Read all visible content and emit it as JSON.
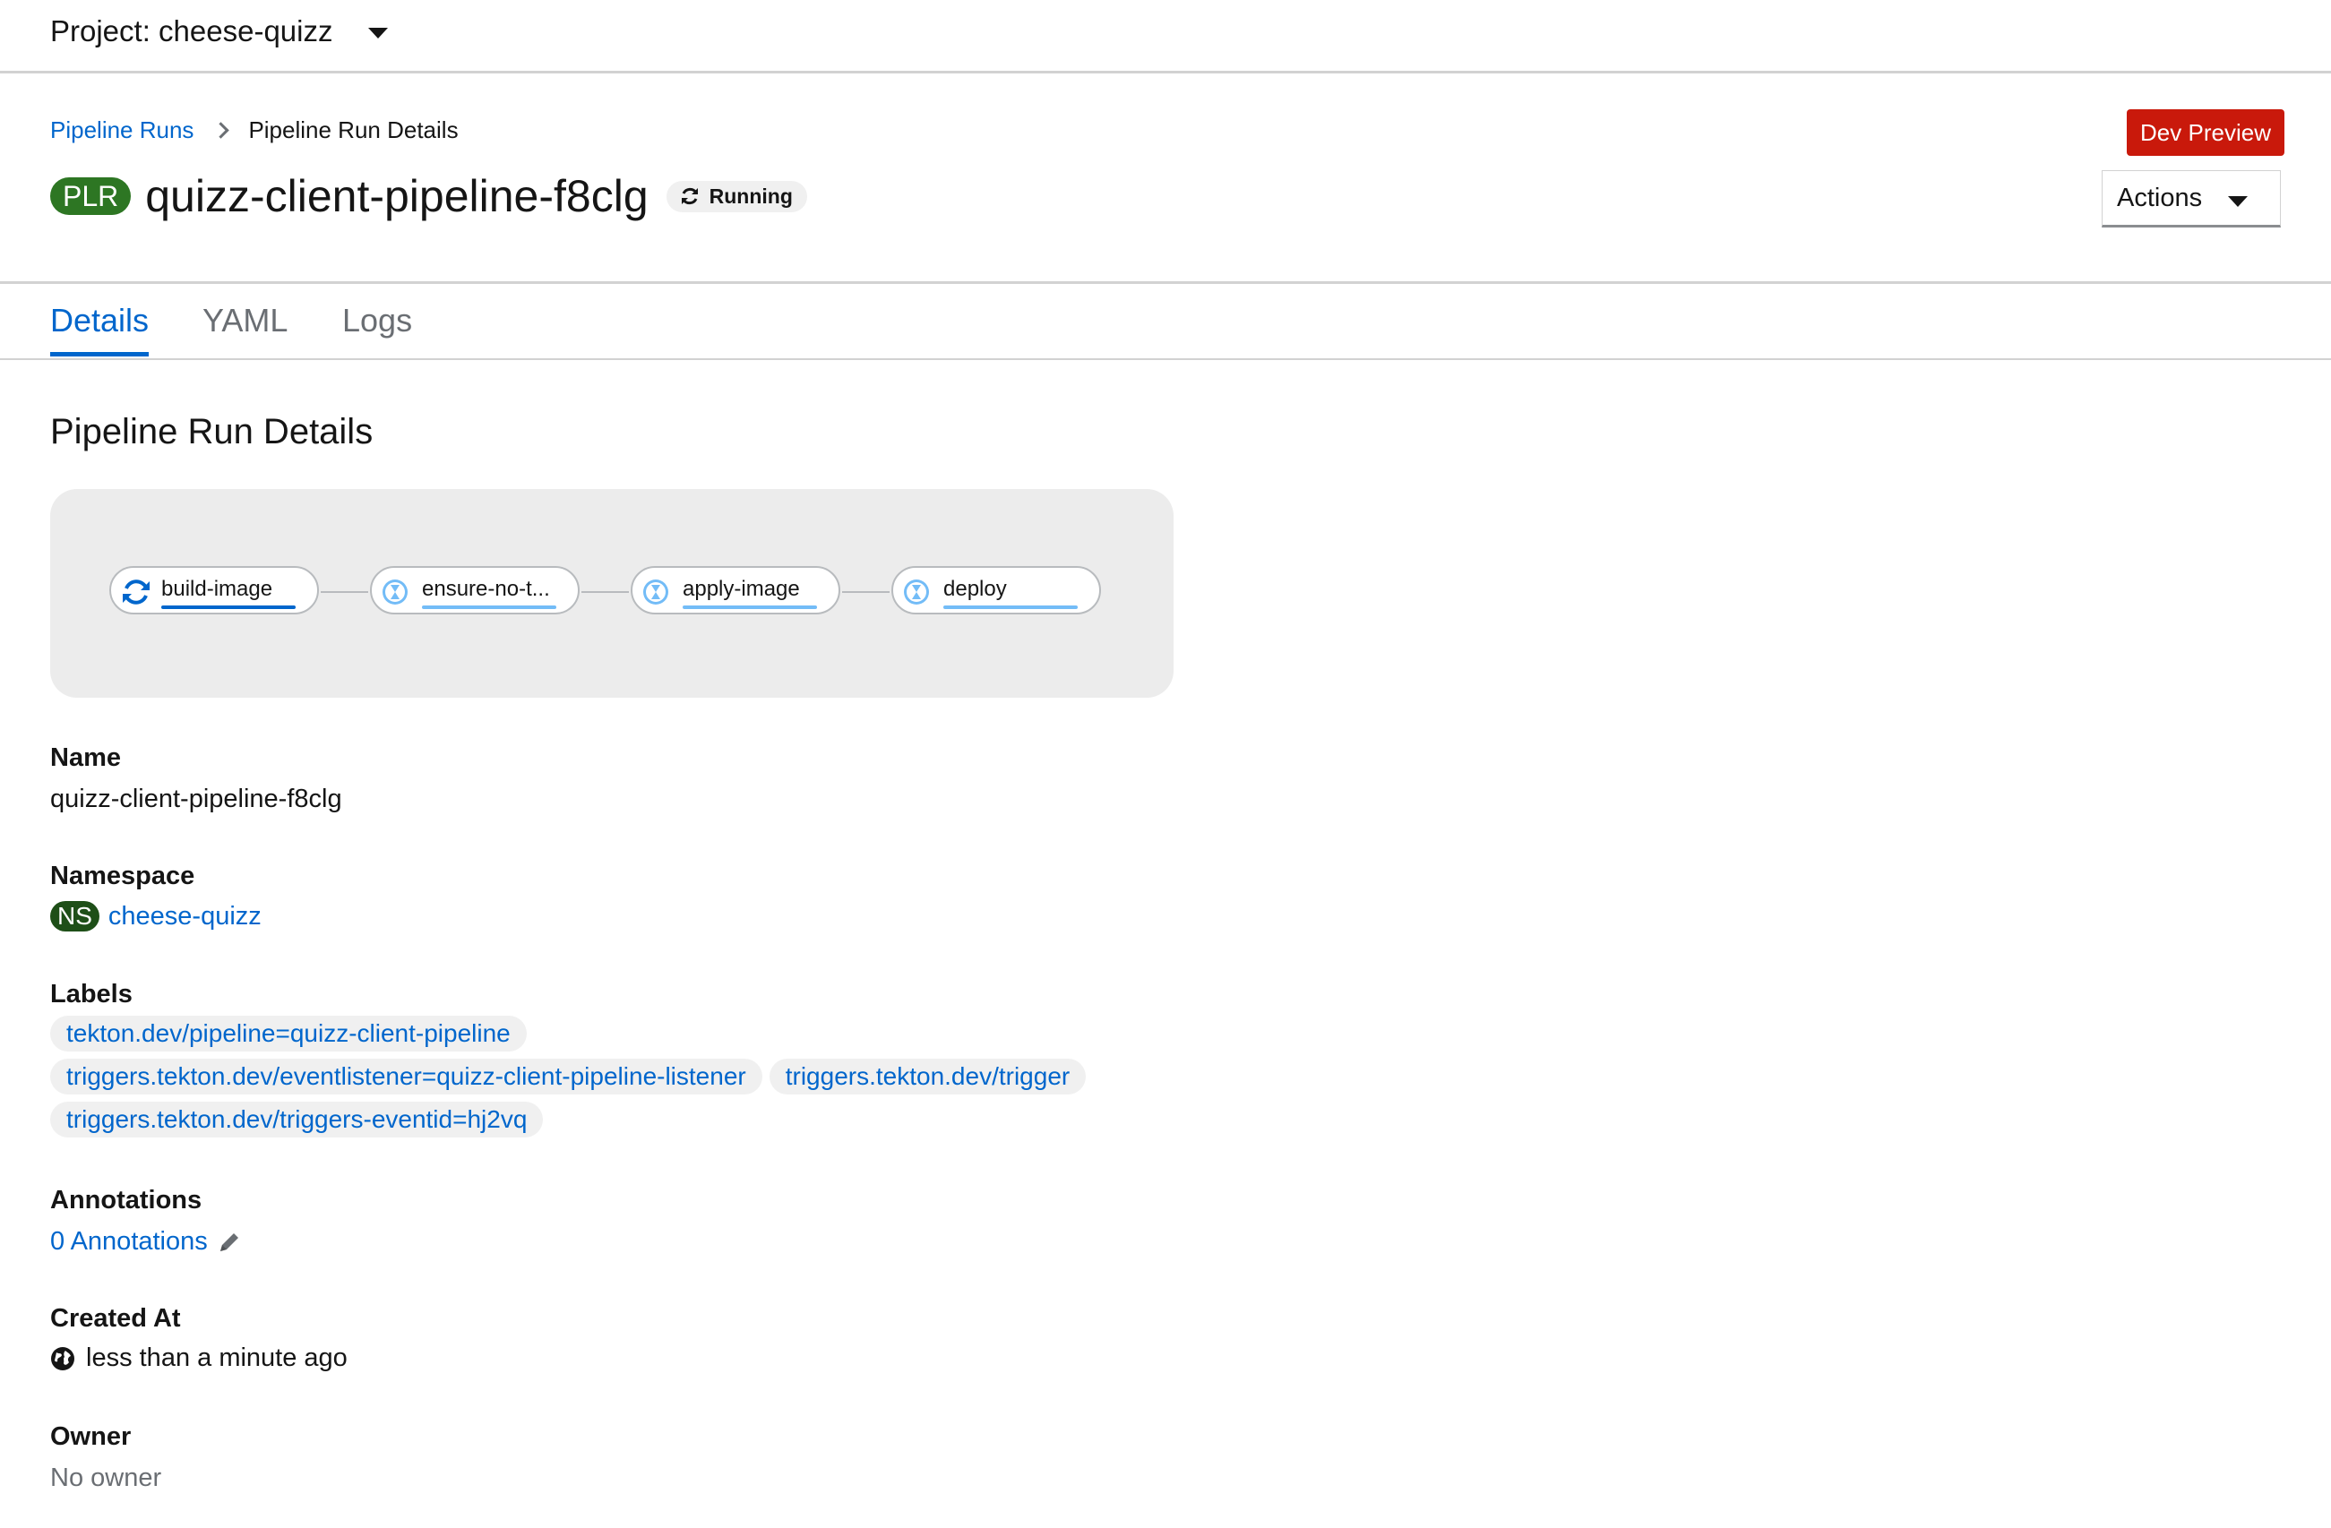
{
  "project_bar": {
    "label": "Project: cheese-quizz"
  },
  "breadcrumb": {
    "parent": "Pipeline Runs",
    "current": "Pipeline Run Details"
  },
  "header": {
    "badge": "PLR",
    "title": "quizz-client-pipeline-f8clg",
    "status": "Running",
    "dev_preview": "Dev Preview",
    "actions": "Actions"
  },
  "tabs": [
    {
      "label": "Details",
      "active": true
    },
    {
      "label": "YAML",
      "active": false
    },
    {
      "label": "Logs",
      "active": false
    }
  ],
  "section_title": "Pipeline Run Details",
  "pipeline_tasks": [
    {
      "name": "build-image",
      "status": "running",
      "icon": "sync-icon",
      "bar_color": "#0066cc"
    },
    {
      "name": "ensure-no-t...",
      "status": "pending",
      "icon": "hourglass-icon",
      "bar_color": "#73bcf7"
    },
    {
      "name": "apply-image",
      "status": "pending",
      "icon": "hourglass-icon",
      "bar_color": "#73bcf7"
    },
    {
      "name": "deploy",
      "status": "pending",
      "icon": "hourglass-icon",
      "bar_color": "#73bcf7"
    }
  ],
  "details": {
    "name_label": "Name",
    "name_value": "quizz-client-pipeline-f8clg",
    "namespace_label": "Namespace",
    "namespace_badge": "NS",
    "namespace_value": "cheese-quizz",
    "labels_label": "Labels",
    "labels": [
      "tekton.dev/pipeline=quizz-client-pipeline",
      "triggers.tekton.dev/eventlistener=quizz-client-pipeline-listener",
      "triggers.tekton.dev/trigger",
      "triggers.tekton.dev/triggers-eventid=hj2vq"
    ],
    "annotations_label": "Annotations",
    "annotations_value": "0 Annotations",
    "created_label": "Created At",
    "created_value": "less than a minute ago",
    "owner_label": "Owner",
    "owner_value": "No owner"
  },
  "colors": {
    "link": "#0066cc",
    "plr_badge": "#2d7623",
    "ns_badge": "#1e4f18",
    "dev_preview": "#c9190b"
  }
}
